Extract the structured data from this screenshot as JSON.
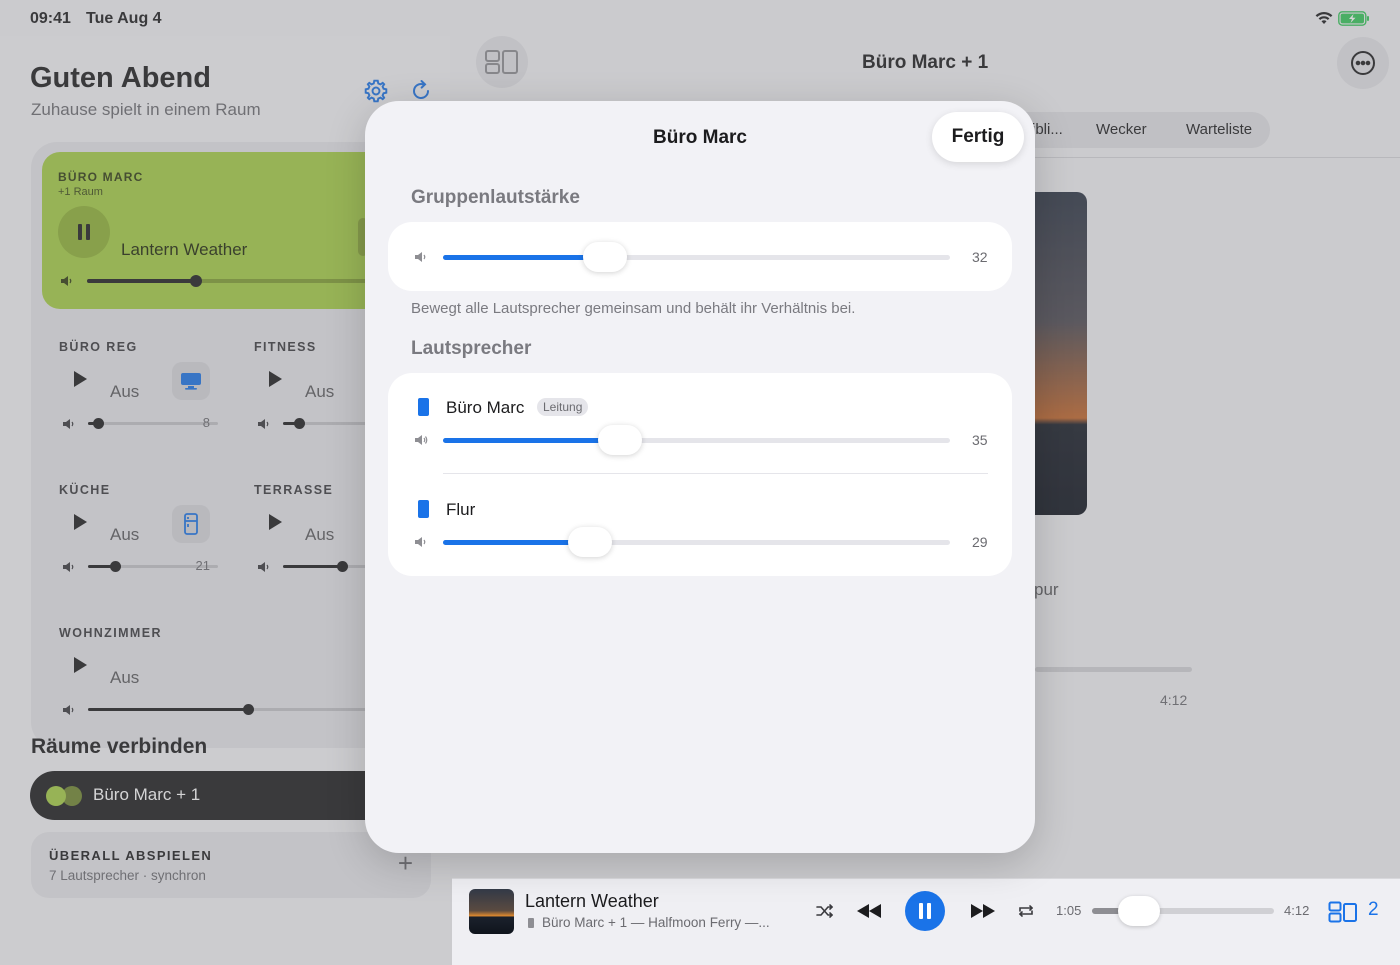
{
  "status": {
    "time": "09:41",
    "date": "Tue Aug 4"
  },
  "sidebar": {
    "greeting": "Guten Abend",
    "subtitle": "Zuhause spielt in einem Raum",
    "active_room": {
      "label": "BÜRO MARC",
      "sub": "+1 Raum",
      "track": "Lantern Weather",
      "volume": 32
    },
    "rooms": [
      {
        "label": "BÜRO REG",
        "state": "Aus",
        "volume_label": "8",
        "volume": 8
      },
      {
        "label": "FITNESS",
        "state": "Aus",
        "volume_label": "",
        "volume": 12
      },
      {
        "label": "KÜCHE",
        "state": "Aus",
        "volume_label": "21",
        "volume": 21
      },
      {
        "label": "TERRASSE",
        "state": "Aus",
        "volume_label": "",
        "volume": 45
      },
      {
        "label": "WOHNZIMMER",
        "state": "Aus",
        "volume_label": "",
        "volume": 50
      }
    ],
    "connect_title": "Räume verbinden",
    "connect_pill": "Büro Marc + 1",
    "everywhere_title": "ÜBERALL ABSPIELEN",
    "everywhere_sub": "7 Lautsprecher · synchron"
  },
  "main": {
    "title": "Büro Marc + 1",
    "tabs": [
      "ibli...",
      "Wecker",
      "Warteliste"
    ],
    "fragment": "pur",
    "duration": "4:12"
  },
  "sheet": {
    "title": "Büro Marc",
    "done_label": "Fertig",
    "group_volume_title": "Gruppenlautstärke",
    "group_volume": 32,
    "group_volume_label": "32",
    "hint": "Bewegt alle Lautsprecher gemeinsam und behält ihr Verhältnis bei.",
    "speakers_title": "Lautsprecher",
    "speakers": [
      {
        "name": "Büro Marc",
        "badge": "Leitung",
        "volume": 35,
        "volume_label": "35"
      },
      {
        "name": "Flur",
        "badge": "",
        "volume": 29,
        "volume_label": "29"
      }
    ]
  },
  "now_playing": {
    "title": "Lantern Weather",
    "subtitle": "Büro Marc + 1 — Halfmoon Ferry —...",
    "elapsed": "1:05",
    "duration": "4:12",
    "progress": 0.26,
    "group_count": "2"
  },
  "colors": {
    "accent": "#1a73e8",
    "room_active": "#a6cf45"
  }
}
